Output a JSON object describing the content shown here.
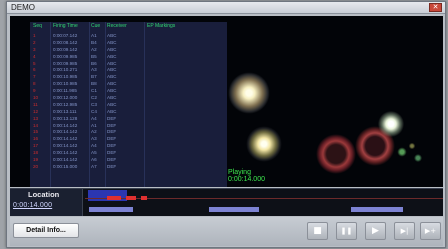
{
  "window": {
    "title": "DEMO",
    "close_glyph": "✕"
  },
  "table": {
    "headers": [
      "Seq",
      "Firing Time",
      "Cue",
      "Receiver",
      "EP Markings"
    ],
    "rows": [
      {
        "seq": "1",
        "time": "0:00:07.142",
        "cue": "A1",
        "receiver": "ABC"
      },
      {
        "seq": "2",
        "time": "0:00:08.142",
        "cue": "B4",
        "receiver": "ABC"
      },
      {
        "seq": "3",
        "time": "0:00:09.142",
        "cue": "A2",
        "receiver": "ABC"
      },
      {
        "seq": "4",
        "time": "0:00:09.985",
        "cue": "B5",
        "receiver": "ABC"
      },
      {
        "seq": "5",
        "time": "0:00:09.985",
        "cue": "B6",
        "receiver": "ABC"
      },
      {
        "seq": "6",
        "time": "0:00:10.271",
        "cue": "A3",
        "receiver": "ABC"
      },
      {
        "seq": "7",
        "time": "0:00:10.985",
        "cue": "B7",
        "receiver": "ABC"
      },
      {
        "seq": "8",
        "time": "0:00:10.985",
        "cue": "B8",
        "receiver": "ABC"
      },
      {
        "seq": "9",
        "time": "0:00:11.985",
        "cue": "C1",
        "receiver": "ABC"
      },
      {
        "seq": "10",
        "time": "0:00:12.000",
        "cue": "C2",
        "receiver": "ABC"
      },
      {
        "seq": "11",
        "time": "0:00:12.985",
        "cue": "C3",
        "receiver": "ABC"
      },
      {
        "seq": "12",
        "time": "0:00:13.111",
        "cue": "C4",
        "receiver": "ABC"
      },
      {
        "seq": "13",
        "time": "0:00:13.128",
        "cue": "A4",
        "receiver": "DEF"
      },
      {
        "seq": "14",
        "time": "0:00:14.142",
        "cue": "A1",
        "receiver": "DEF"
      },
      {
        "seq": "15",
        "time": "0:00:14.142",
        "cue": "A2",
        "receiver": "DEF"
      },
      {
        "seq": "16",
        "time": "0:00:14.142",
        "cue": "A3",
        "receiver": "DEF"
      },
      {
        "seq": "17",
        "time": "0:00:14.142",
        "cue": "A4",
        "receiver": "DEF"
      },
      {
        "seq": "18",
        "time": "0:00:14.142",
        "cue": "A5",
        "receiver": "DEF"
      },
      {
        "seq": "19",
        "time": "0:00:14.142",
        "cue": "A6",
        "receiver": "DEF"
      },
      {
        "seq": "20",
        "time": "0:00:15.000",
        "cue": "A7",
        "receiver": "DEF"
      }
    ]
  },
  "status": {
    "state": "Playing",
    "time": "0:00:14.000"
  },
  "location": {
    "label": "Location",
    "value": "0:00:14.000"
  },
  "controls": {
    "detail_label": "Detail Info...",
    "stop_glyph": "■",
    "pause_glyph": "❚❚",
    "play_glyph": "▶",
    "next_glyph": "▶|",
    "add_glyph": "▶+"
  },
  "colors": {
    "accent_green": "#36e87a",
    "seq_red": "#e03030",
    "stage_bg": "#020408",
    "table_bg": "#1b2140",
    "progress_blue": "#3340d8"
  },
  "playback_progress": 0.11
}
